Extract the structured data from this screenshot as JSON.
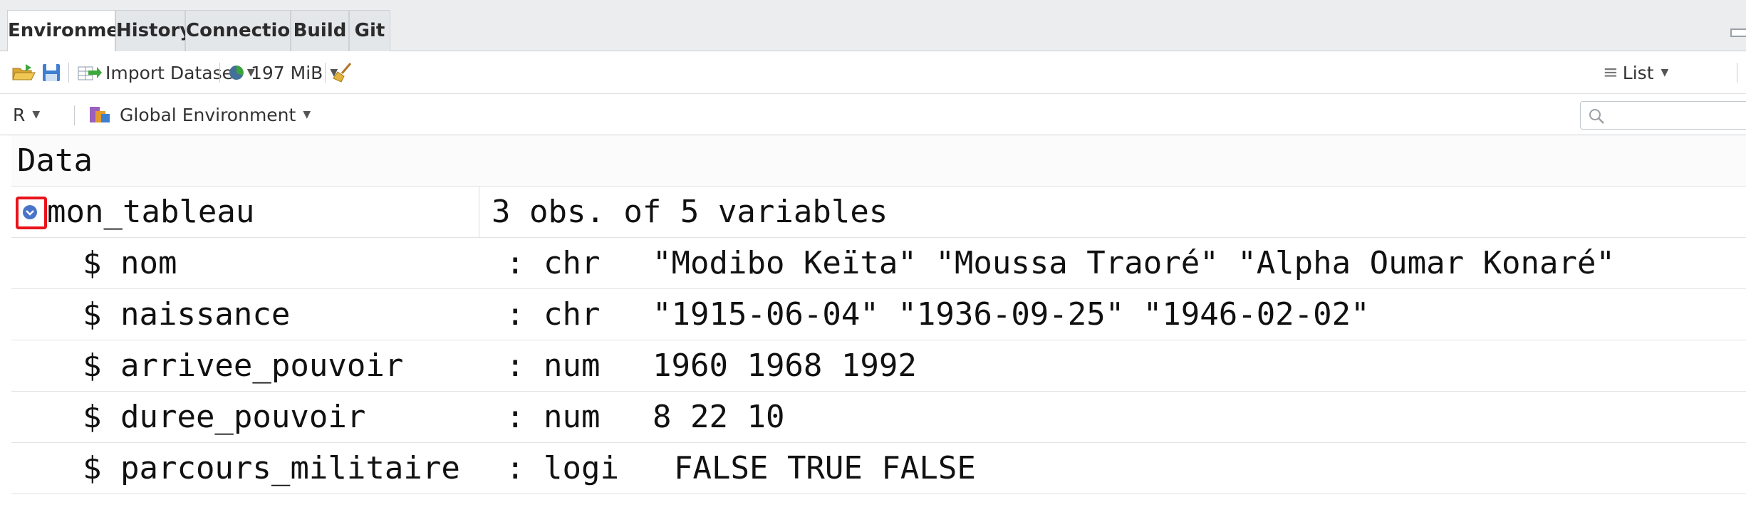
{
  "tabs": [
    {
      "label": "Environment",
      "active": true
    },
    {
      "label": "History",
      "active": false
    },
    {
      "label": "Connections",
      "active": false
    },
    {
      "label": "Build",
      "active": false
    },
    {
      "label": "Git",
      "active": false
    }
  ],
  "toolbar": {
    "import_dataset_label": "Import Dataset",
    "memory_label": "197 MiB",
    "view_mode_label": "List"
  },
  "toolbar2": {
    "language_label": "R",
    "environment_label": "Global Environment",
    "search_placeholder": ""
  },
  "environment": {
    "section_title": "Data",
    "object": {
      "name": "mon_tableau",
      "summary": "3 obs. of 5 variables",
      "expanded": true
    },
    "variables": [
      {
        "name": "$ nom",
        "type": ": chr",
        "values": "\"Modibo Keïta\" \"Moussa Traoré\" \"Alpha Oumar Konaré\""
      },
      {
        "name": "$ naissance",
        "type": ": chr",
        "values": "\"1915-06-04\" \"1936-09-25\" \"1946-02-02\""
      },
      {
        "name": "$ arrivee_pouvoir",
        "type": ": num",
        "values": "1960 1968 1992"
      },
      {
        "name": "$ duree_pouvoir",
        "type": ": num",
        "values": "8 22 10"
      },
      {
        "name": "$ parcours_militaire",
        "type": ": logi",
        "values": "FALSE TRUE FALSE"
      }
    ]
  },
  "colors": {
    "highlight": "#e8131b",
    "expand_icon": "#4a74c9"
  }
}
